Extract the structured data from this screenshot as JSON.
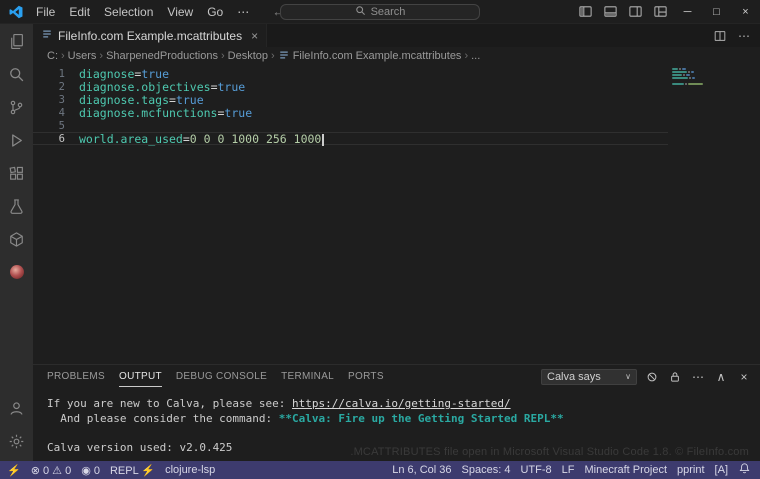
{
  "colors": {
    "statusbar_bg": "#3d3b6e",
    "token_key": "#4ec9b0",
    "token_bool": "#569cd6",
    "token_number": "#b5cea8",
    "output_emphasis": "#2aa9a2"
  },
  "titlebar": {
    "menus": [
      "File",
      "Edit",
      "Selection",
      "View",
      "Go"
    ],
    "overflow": "⋯",
    "back": "←",
    "forward": "→",
    "search_placeholder": "Search",
    "window_controls": {
      "minimize": "─",
      "maximize": "□",
      "close": "×"
    }
  },
  "activitybar": {
    "items": [
      {
        "name": "explorer",
        "icon": "files"
      },
      {
        "name": "search",
        "icon": "search"
      },
      {
        "name": "source-control",
        "icon": "git"
      },
      {
        "name": "run-and-debug",
        "icon": "debug"
      },
      {
        "name": "extensions",
        "icon": "extensions"
      },
      {
        "name": "testing",
        "icon": "flask"
      },
      {
        "name": "minecraft-tools",
        "icon": "cube"
      },
      {
        "name": "calva",
        "icon": "calva"
      }
    ],
    "bottom": [
      {
        "name": "accounts",
        "icon": "account"
      },
      {
        "name": "manage",
        "icon": "gear"
      }
    ]
  },
  "tabs": {
    "active_tab": "FileInfo.com Example.mcattributes",
    "close": "×",
    "more": "⋯"
  },
  "breadcrumbs": [
    {
      "label": "C:"
    },
    {
      "label": "Users"
    },
    {
      "label": "SharpenedProductions"
    },
    {
      "label": "Desktop"
    },
    {
      "label": "FileInfo.com Example.mcattributes",
      "icon": "file"
    },
    {
      "label": "..."
    }
  ],
  "editor": {
    "lines": [
      {
        "num": 1,
        "tokens": [
          [
            "key",
            "diagnose"
          ],
          [
            "op",
            "="
          ],
          [
            "bool",
            "true"
          ]
        ]
      },
      {
        "num": 2,
        "tokens": [
          [
            "key",
            "diagnose.objectives"
          ],
          [
            "op",
            "="
          ],
          [
            "bool",
            "true"
          ]
        ]
      },
      {
        "num": 3,
        "tokens": [
          [
            "key",
            "diagnose.tags"
          ],
          [
            "op",
            "="
          ],
          [
            "bool",
            "true"
          ]
        ]
      },
      {
        "num": 4,
        "tokens": [
          [
            "key",
            "diagnose.mcfunctions"
          ],
          [
            "op",
            "="
          ],
          [
            "bool",
            "true"
          ]
        ]
      },
      {
        "num": 5,
        "tokens": []
      },
      {
        "num": 6,
        "tokens": [
          [
            "key",
            "world.area_used"
          ],
          [
            "op",
            "="
          ],
          [
            "num",
            "0 0 0 1000 256 1000"
          ]
        ],
        "current": true
      }
    ]
  },
  "panel": {
    "tabs": [
      {
        "label": "PROBLEMS",
        "active": false
      },
      {
        "label": "OUTPUT",
        "active": true
      },
      {
        "label": "DEBUG CONSOLE",
        "active": false
      },
      {
        "label": "TERMINAL",
        "active": false
      },
      {
        "label": "PORTS",
        "active": false
      }
    ],
    "channel_select": "Calva says",
    "chevron": "∨",
    "actions_more": "⋯",
    "actions_maximize": "∧",
    "actions_close": "×",
    "output_lines": [
      [
        {
          "s": "plain",
          "t": "If you are new to Calva, please see: "
        },
        {
          "s": "link",
          "t": "https://calva.io/getting-started/"
        }
      ],
      [
        {
          "s": "plain",
          "t": "  And please consider the command: "
        },
        {
          "s": "emph",
          "t": "**Calva: Fire up the Getting Started REPL**"
        }
      ],
      [],
      [
        {
          "s": "plain",
          "t": "Calva version used: v2.0.425"
        }
      ]
    ],
    "watermark": ".MCATTRIBUTES file open in Microsoft Visual Studio Code 1.8. © FileInfo.com"
  },
  "statusbar": {
    "left": [
      {
        "name": "remote-indicator",
        "text": "⚡"
      },
      {
        "name": "problems-indicator",
        "text": "⊗ 0  ⚠ 0"
      },
      {
        "name": "ports-indicator",
        "text": "◉ 0"
      },
      {
        "name": "calva-repl-status",
        "text": "REPL ⚡"
      },
      {
        "name": "clojure-lsp-status",
        "text": "clojure-lsp"
      }
    ],
    "right": [
      {
        "name": "cursor-position",
        "text": "Ln 6, Col 36"
      },
      {
        "name": "indentation",
        "text": "Spaces: 4"
      },
      {
        "name": "encoding",
        "text": "UTF-8"
      },
      {
        "name": "eol-sequence",
        "text": "LF"
      },
      {
        "name": "language-mode",
        "text": "Minecraft Project"
      },
      {
        "name": "pprint-toggle",
        "text": "pprint"
      },
      {
        "name": "mode-indicator",
        "text": "[A]"
      },
      {
        "name": "notifications-button",
        "icon": "bell"
      }
    ]
  }
}
